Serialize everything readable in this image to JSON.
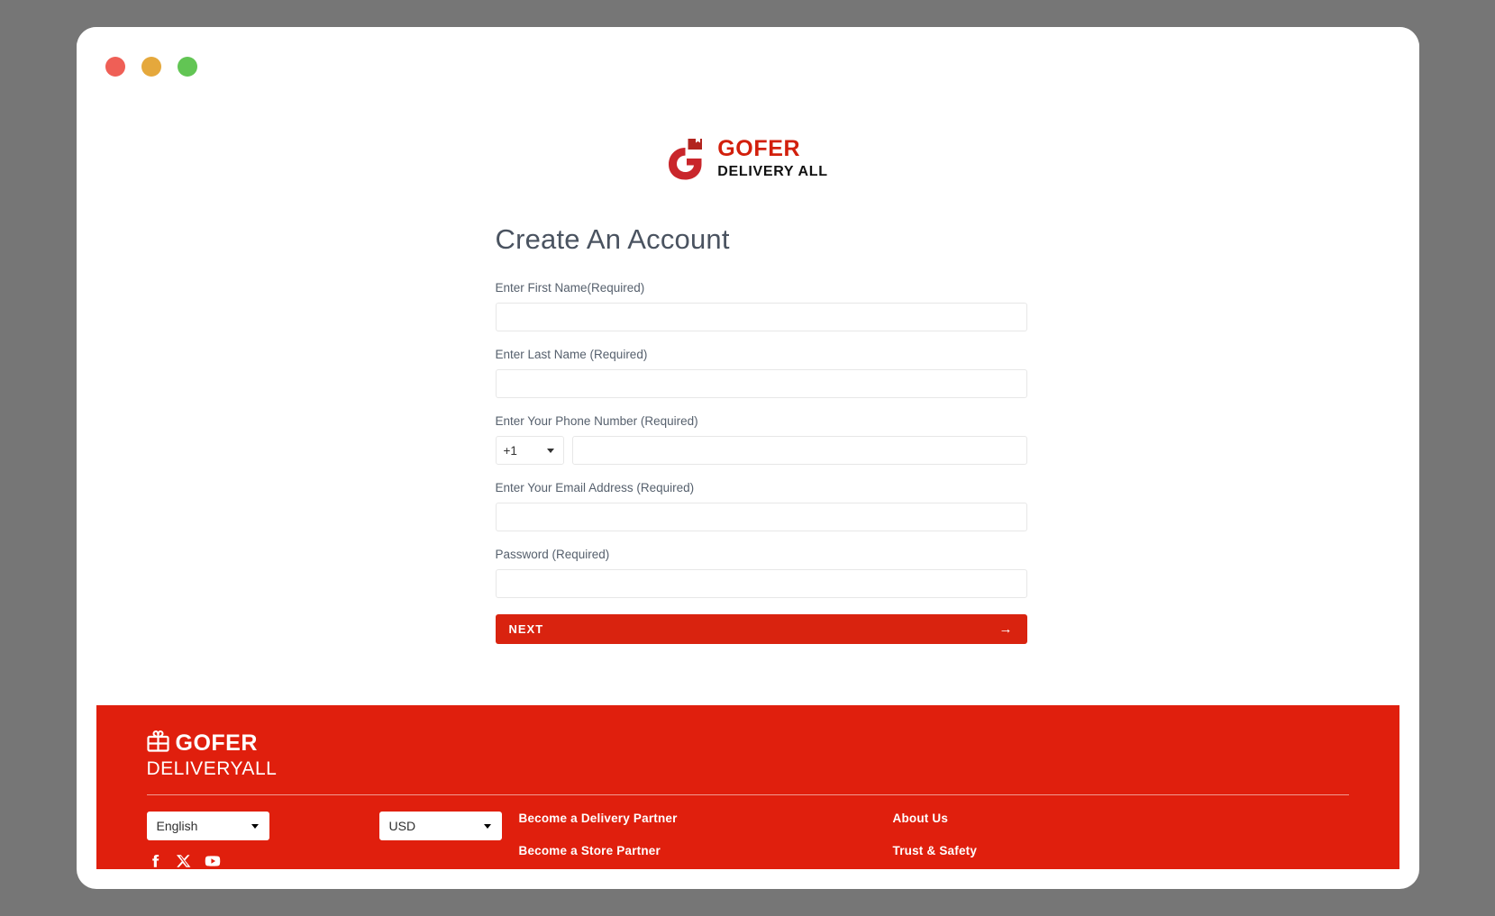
{
  "window": {
    "traffic_lights": [
      "close",
      "minimize",
      "maximize"
    ]
  },
  "header": {
    "logo": {
      "mark": "gofer-g-box-icon",
      "primary_text": "GOFER",
      "secondary_text": "DELIVERY ALL",
      "primary_color": "#d21f0c",
      "secondary_color": "#111111"
    }
  },
  "main": {
    "title": "Create An Account",
    "fields": [
      {
        "name": "first-name",
        "label": "Enter First Name(Required)",
        "value": "",
        "placeholder": ""
      },
      {
        "name": "last-name",
        "label": "Enter Last Name (Required)",
        "value": "",
        "placeholder": ""
      },
      {
        "name": "phone",
        "label": "Enter Your Phone Number (Required)",
        "value": "",
        "placeholder": "",
        "country_code": "+1"
      },
      {
        "name": "email",
        "label": "Enter Your Email Address (Required)",
        "value": "",
        "placeholder": ""
      },
      {
        "name": "password",
        "label": "Password (Required)",
        "value": "",
        "placeholder": ""
      }
    ],
    "submit": {
      "label": "NEXT",
      "arrow": "→",
      "color": "#d9230f"
    }
  },
  "footer": {
    "background_color": "#e01f0d",
    "logo": {
      "mark": "gift-box-icon",
      "primary_text": "GOFER",
      "secondary_text": "DELIVERYALL"
    },
    "language_select": {
      "value": "English",
      "caret": "chevron-down-icon"
    },
    "currency_select": {
      "value": "USD",
      "caret": "chevron-down-icon"
    },
    "links_column_1": [
      "Become a Delivery Partner",
      "Become a Store Partner"
    ],
    "links_column_2": [
      "About Us",
      "Trust & Safety"
    ],
    "social": [
      "facebook-icon",
      "x-twitter-icon",
      "youtube-icon"
    ]
  }
}
